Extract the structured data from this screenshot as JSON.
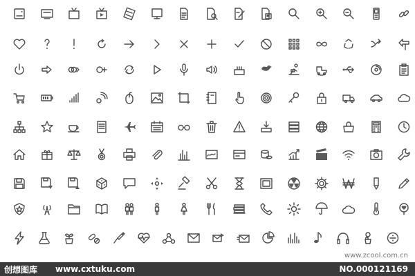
{
  "watermark_text": "www.zcool.com.cn",
  "footer": {
    "brand": "创想图库",
    "site": "www.cxtuku.com",
    "number": "NO.000121169"
  },
  "icon_color": "#4d4d4d",
  "footer_color": "#3a3a3a",
  "rows": [
    [
      "disk-icon",
      "monitor-icon",
      "tv-icon",
      "tv-play-icon",
      "film-icon",
      "desktop-icon",
      "document-icon",
      "document-search-icon",
      "document-edit-icon",
      "document-image-icon",
      "zoom-icon",
      "zoom-in-icon",
      "zoom-out-icon",
      "mobile-phone-icon",
      "link-icon"
    ],
    [
      "heart-icon",
      "question-icon",
      "exclamation-icon",
      "refresh-icon",
      "arrow-right-icon",
      "chevron-right-icon",
      "close-icon",
      "plus-icon",
      "check-icon",
      "no-entry-icon",
      "grid-icon",
      "infinity-icon",
      "recycle-icon",
      "shuffle-icon",
      "direction-sign-icon"
    ],
    [
      "power-icon",
      "arrow-right-outline-icon",
      "double-circle-arrow-icon",
      "circle-arrow-icon",
      "sync-icon",
      "play-icon",
      "microphone-icon",
      "speaker-icon",
      "birthday-cake-icon",
      "bird-icon",
      "person-reading-icon",
      "baby-carriage-icon",
      "usb-icon",
      "disc-icon",
      "clipboard-icon"
    ],
    [
      "shopping-cart-icon",
      "battery-icon",
      "signal-icon",
      "satellite-icon",
      "mouse-icon",
      "image-icon",
      "crop-icon",
      "notebook-icon",
      "hand-pointer-icon",
      "target-icon",
      "key-icon",
      "padlock-icon",
      "truck-icon",
      "car-icon",
      "cloud-tag-icon"
    ],
    [
      "sitemap-icon",
      "star-icon",
      "coffee-cup-icon",
      "storage-box-icon",
      "airplane-icon",
      "calendar-icon",
      "glasses-icon",
      "trash-icon",
      "warning-icon",
      "download-tray-icon",
      "server-icon",
      "globe-icon",
      "handbag-icon",
      "calculator-icon",
      "clock-icon"
    ],
    [
      "home-icon",
      "gift-icon",
      "scales-icon",
      "medal-icon",
      "printer-icon",
      "paperclip-icon",
      "bar-chart-icon",
      "signature-icon",
      "credit-card-icon",
      "coins-icon",
      "chart-growth-icon",
      "clapperboard-icon",
      "wifi-icon",
      "camera-icon",
      "wrench-icon"
    ],
    [
      "floppy-icon",
      "floppy-download-icon",
      "floppy-upload-icon",
      "dice-icon",
      "speech-bubble-icon",
      "move-arrows-icon",
      "gavel-icon",
      "scissors-icon",
      "hourglass-icon",
      "picture-frame-icon",
      "radiation-icon",
      "gear-icon",
      "won-currency-icon",
      "pencil-tip-icon",
      "pencil-icon"
    ],
    [
      "shield-icon",
      "broadcast-tower-icon",
      "folder-icon",
      "open-book-icon",
      "people-icon",
      "male-icon",
      "female-icon",
      "fork-knife-icon",
      "books-stack-icon",
      "phone-icon",
      "sun-icon",
      "umbrella-icon",
      "cloud-icon",
      "thermometer-icon",
      "heart-location-icon"
    ],
    [
      "lightning-icon",
      "flask-icon",
      "plant-pot-icon",
      "pills-icon",
      "syringe-icon",
      "heartbeat-icon",
      "molecule-icon",
      "envelope-icon",
      "envelope-forward-icon",
      "envelope-send-icon",
      "pie-chart-icon",
      "equalizer-icon",
      "music-note-icon",
      "headphones-icon",
      "flower-pot-icon",
      "divide-icon"
    ]
  ]
}
